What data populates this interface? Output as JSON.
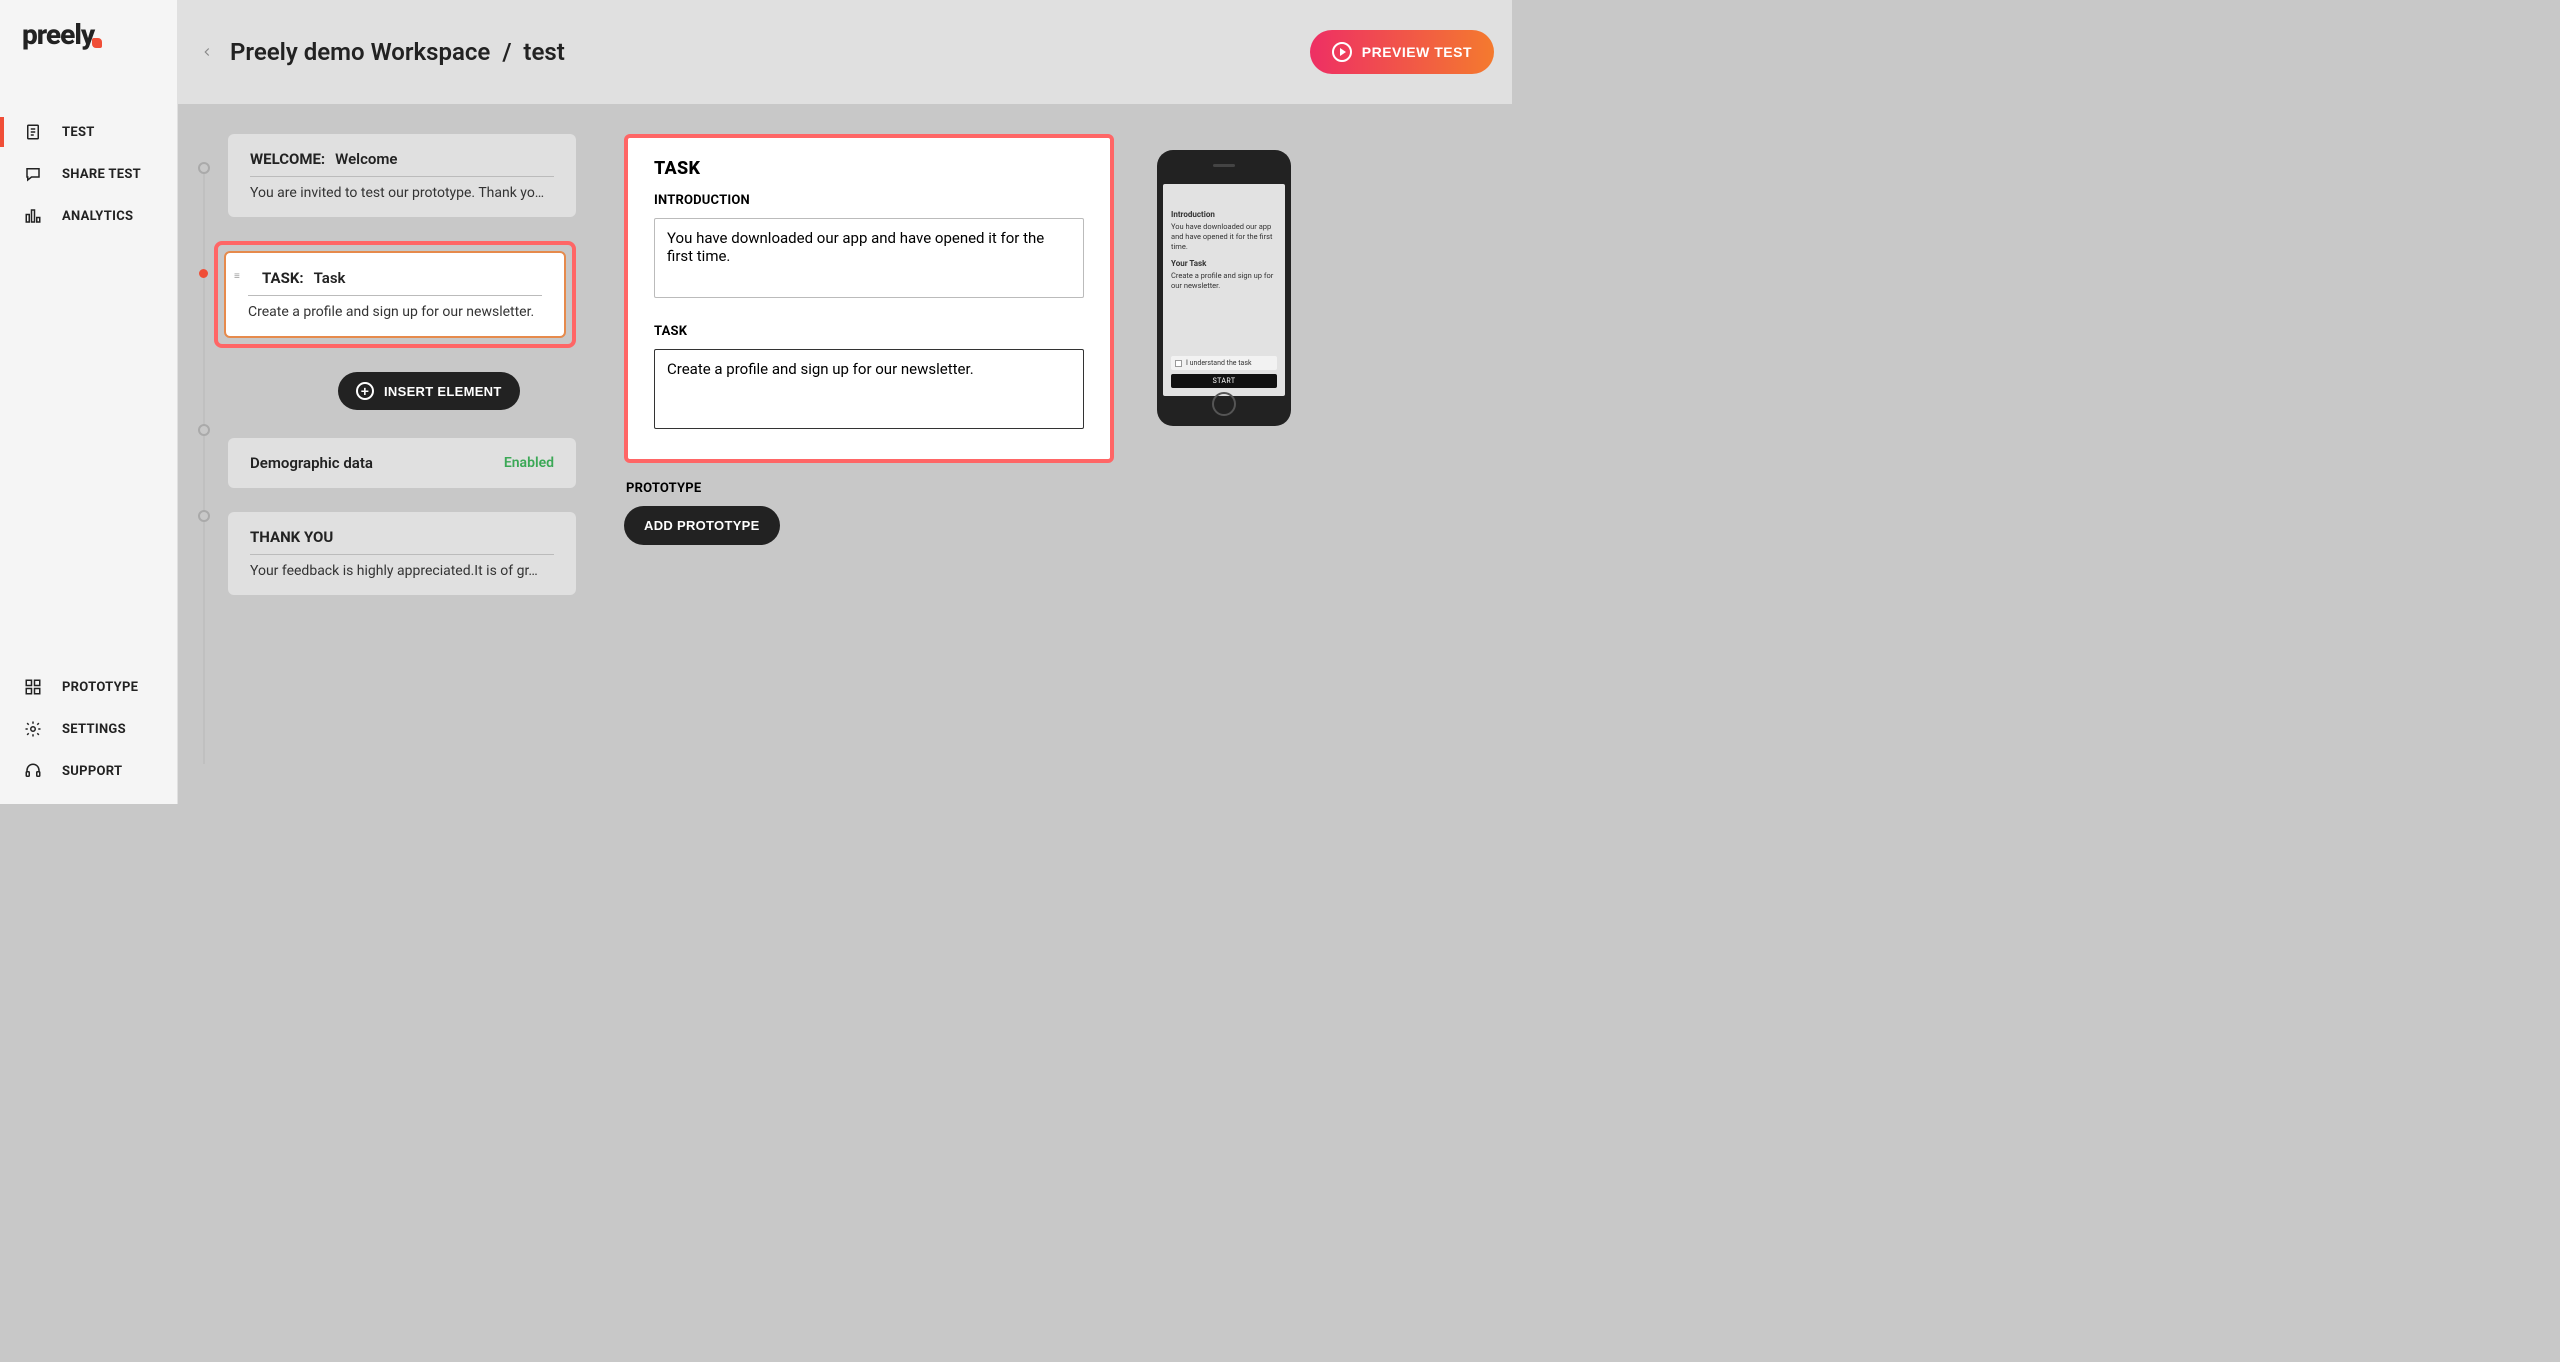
{
  "brand": "preely",
  "sidebar": {
    "top": [
      {
        "label": "TEST"
      },
      {
        "label": "SHARE TEST"
      },
      {
        "label": "ANALYTICS"
      }
    ],
    "bottom": [
      {
        "label": "PROTOTYPE"
      },
      {
        "label": "SETTINGS"
      },
      {
        "label": "SUPPORT"
      }
    ]
  },
  "header": {
    "workspace": "Preely demo Workspace",
    "sep": "/",
    "current": "test",
    "preview": "PREVIEW TEST"
  },
  "flow": {
    "welcome": {
      "tag": "WELCOME:",
      "name": "Welcome",
      "body": "You are invited to test our prototype. Thank yo…"
    },
    "task": {
      "tag": "TASK:",
      "name": "Task",
      "body": "Create a profile and sign up for our newsletter."
    },
    "insert": "INSERT ELEMENT",
    "demo": {
      "name": "Demographic data",
      "status": "Enabled"
    },
    "thanks": {
      "tag": "THANK YOU",
      "body": "Your feedback is highly appreciated.It is of gr…"
    }
  },
  "detail": {
    "heading": "TASK",
    "intro_label": "INTRODUCTION",
    "intro_value": "You have downloaded our app and have opened it for the first time.",
    "task_label": "TASK",
    "task_value": "Create a profile and sign up for our newsletter.",
    "prototype_label": "PROTOTYPE",
    "add_prototype": "ADD PROTOTYPE"
  },
  "phone": {
    "intro_h": "Introduction",
    "intro_t": "You have downloaded our app and have opened it for the first time.",
    "task_h": "Your Task",
    "task_t": "Create a profile and sign up for our newsletter.",
    "check": "I understand the task",
    "start": "START"
  }
}
